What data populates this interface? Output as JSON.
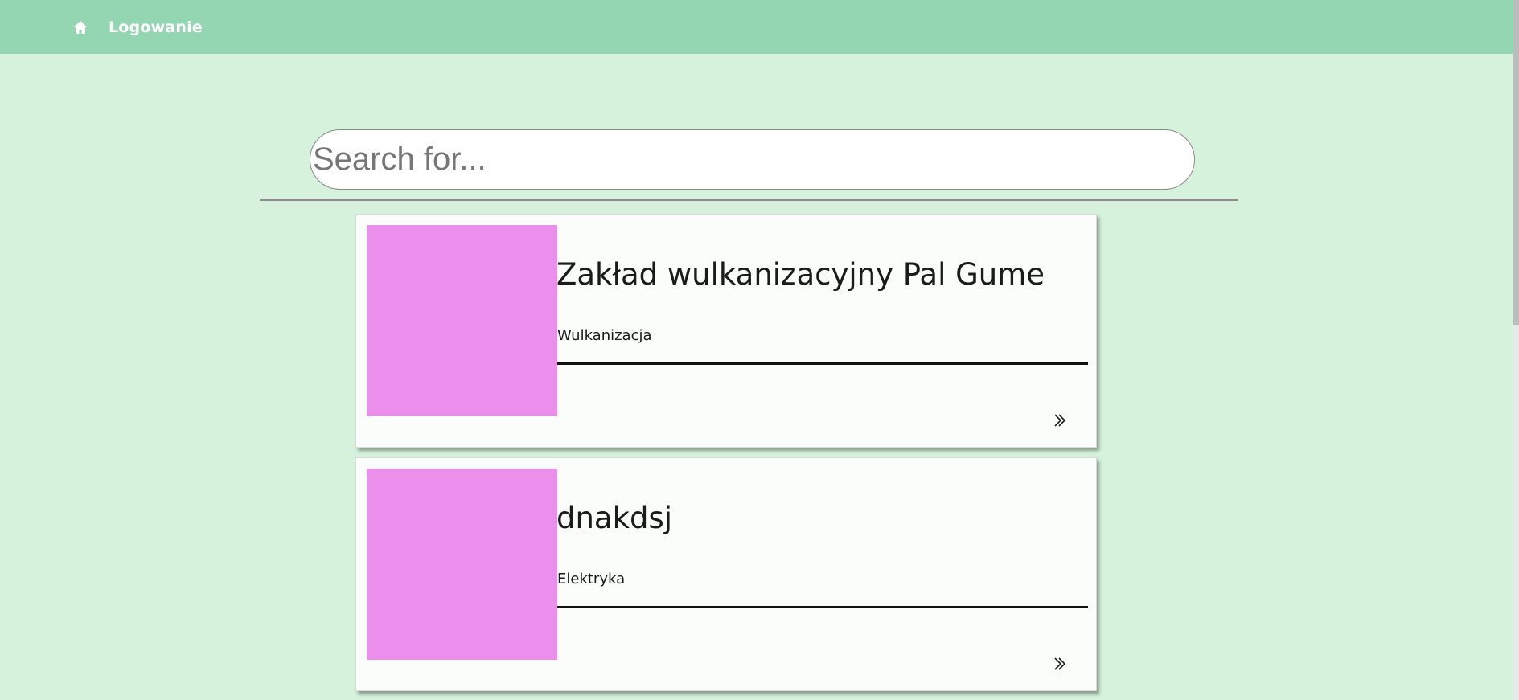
{
  "nav": {
    "home_icon": "home-icon",
    "login_label": "Logowanie"
  },
  "search": {
    "placeholder": "Search for...",
    "value": ""
  },
  "listings": [
    {
      "title": "Zakład wulkanizacyjny Pal Gume",
      "category": "Wulkanizacja",
      "thumbnail_color": "#ec8eec",
      "arrow_icon": "double-chevron-right-icon"
    },
    {
      "title": "dnakdsj",
      "category": "Elektryka",
      "thumbnail_color": "#ec8eec",
      "arrow_icon": "double-chevron-right-icon"
    }
  ],
  "colors": {
    "navbar": "#95d6b2",
    "background": "#d6f2dd",
    "card": "#fafdfa",
    "thumbnail": "#ec8eec"
  }
}
